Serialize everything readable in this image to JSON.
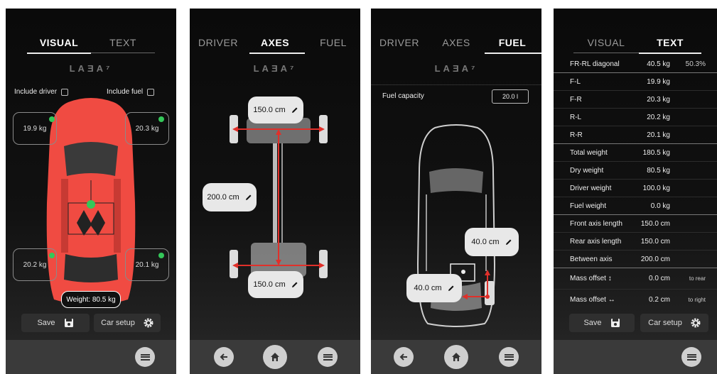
{
  "visual": {
    "tabs": [
      "VISUAL",
      "TEXT"
    ],
    "logo": "LAƎA⁷",
    "include_driver": "Include driver",
    "include_fuel": "Include fuel",
    "fl": "19.9 kg",
    "fr": "20.3 kg",
    "rl": "20.2 kg",
    "rr": "20.1 kg",
    "weight": "Weight: 80.5 kg",
    "save": "Save",
    "car_setup": "Car setup",
    "colors": {
      "car": "#f04b42",
      "ok_dot": "#34c759"
    }
  },
  "axes": {
    "tabs": [
      "DRIVER",
      "AXES",
      "FUEL"
    ],
    "logo": "LAƎA⁷",
    "front_width": "150.0 cm",
    "wheelbase": "200.0 cm",
    "rear_width": "150.0 cm",
    "colors": {
      "arrow": "#e0302a"
    }
  },
  "fuel": {
    "tabs": [
      "DRIVER",
      "AXES",
      "FUEL"
    ],
    "logo": "LAƎA⁷",
    "capacity_label": "Fuel capacity",
    "capacity_value": "20.0 l",
    "offset_y": "40.0 cm",
    "offset_x": "40.0 cm"
  },
  "text": {
    "tabs": [
      "VISUAL",
      "TEXT"
    ],
    "rows": [
      {
        "label": "FR-RL diagonal",
        "value": "40.5 kg",
        "extra": "50.3%"
      },
      {
        "label": "F-L",
        "value": "19.9 kg",
        "extra": ""
      },
      {
        "label": "F-R",
        "value": "20.3 kg",
        "extra": ""
      },
      {
        "label": "R-L",
        "value": "20.2 kg",
        "extra": ""
      },
      {
        "label": "R-R",
        "value": "20.1 kg",
        "extra": ""
      },
      {
        "label": "Total weight",
        "value": "180.5 kg",
        "extra": ""
      },
      {
        "label": "Dry weight",
        "value": "80.5 kg",
        "extra": ""
      },
      {
        "label": "Driver weight",
        "value": "100.0 kg",
        "extra": ""
      },
      {
        "label": "Fuel weight",
        "value": "0.0 kg",
        "extra": ""
      },
      {
        "label": "Front axis length",
        "value": "150.0 cm",
        "extra": ""
      },
      {
        "label": "Rear axis length",
        "value": "150.0 cm",
        "extra": ""
      },
      {
        "label": "Between axis",
        "value": "200.0 cm",
        "extra": ""
      },
      {
        "label": "Mass offset ↕",
        "value": "0.0 cm",
        "extra": "to rear"
      },
      {
        "label": "Mass offset ↔",
        "value": "0.2 cm",
        "extra": "to right"
      }
    ],
    "save": "Save",
    "car_setup": "Car setup"
  },
  "icons": [
    "save-icon",
    "gear-icon",
    "menu-icon",
    "back-icon",
    "home-icon",
    "edit-icon",
    "checkbox-icon"
  ]
}
